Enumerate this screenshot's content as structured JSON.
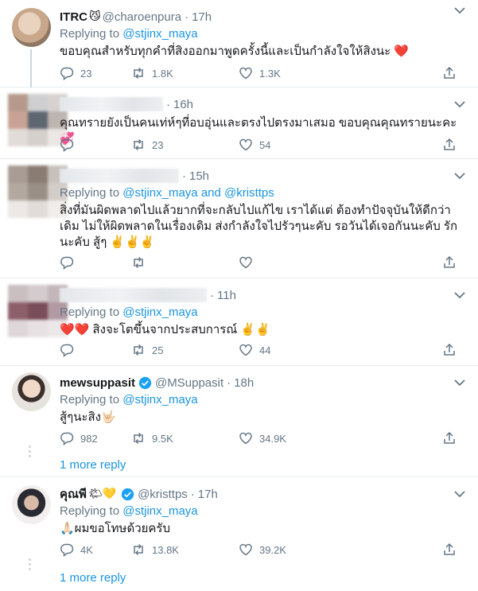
{
  "tweets": [
    {
      "name": "ITRC",
      "name_emoji": "😼",
      "handle": "@charoenpura",
      "time": "17h",
      "replying_prefix": "Replying to",
      "replying_to": "@stjinx_maya",
      "text": "ขอบคุณสำหรับทุกคำที่สิงออกมาพูดครั้งนี้และเป็นกำลังใจให้สิงนะ ❤️",
      "replies": "23",
      "retweets": "1.8K",
      "likes": "1.3K"
    },
    {
      "time": "16h",
      "text": "คุณทรายยังเป็นคนเท่ห์ๆที่อบอุ่นและตรงไปตรงมาเสมอ ขอบคุณคุณทรายนะคะ 💞",
      "replies": "",
      "retweets": "23",
      "likes": "54"
    },
    {
      "time": "15h",
      "replying_prefix": "Replying to",
      "replying_to": "@stjinx_maya",
      "replying_and": "and",
      "replying_to_2": "@kristtps",
      "text": "สิ่งที่มันผิดพลาดไปแล้วยากที่จะกลับไปแก้ไข เราได้แต่ ต้องทำปัจจุบันให้ดีกว่าเดิม ไม่ให้ผิดพลาดในเรื่องเดิม ส่งกำลังใจไปรัวๆนะคับ รอวันได้เจอกันนะคับ รักนะคับ สู้ๆ ✌️✌️✌️",
      "replies": "",
      "retweets": "",
      "likes": ""
    },
    {
      "time": "11h",
      "replying_prefix": "Replying to",
      "replying_to": "@stjinx_maya",
      "text": "❤️❤️ สิงจะโตขึ้นจากประสบการณ์ ✌️✌️",
      "replies": "",
      "retweets": "25",
      "likes": "44"
    },
    {
      "name": "mewsuppasit",
      "handle": "@MSuppasit",
      "time": "18h",
      "replying_prefix": "Replying to",
      "replying_to": "@stjinx_maya",
      "text": "สู้ๆนะสิง🤟🏻",
      "replies": "982",
      "retweets": "9.5K",
      "likes": "34.9K",
      "more_replies": "1 more reply"
    },
    {
      "name": "คุณพี",
      "name_emoji": "🌤💛",
      "handle": "@kristtps",
      "time": "17h",
      "replying_prefix": "Replying to",
      "replying_to": "@stjinx_maya",
      "text": "🙏🏻ผมขอโทษด้วยครับ",
      "replies": "4K",
      "retweets": "13.8K",
      "likes": "39.2K",
      "more_replies": "1 more reply"
    }
  ],
  "colors": {
    "link": "#1b95e0",
    "muted": "#657786",
    "verified": "#1da1f2",
    "heart": "#e0245e",
    "divider": "#e6ecf0"
  },
  "icons": [
    "reply-icon",
    "retweet-icon",
    "like-icon",
    "share-icon",
    "chevron-down-icon",
    "verified-badge-icon"
  ]
}
